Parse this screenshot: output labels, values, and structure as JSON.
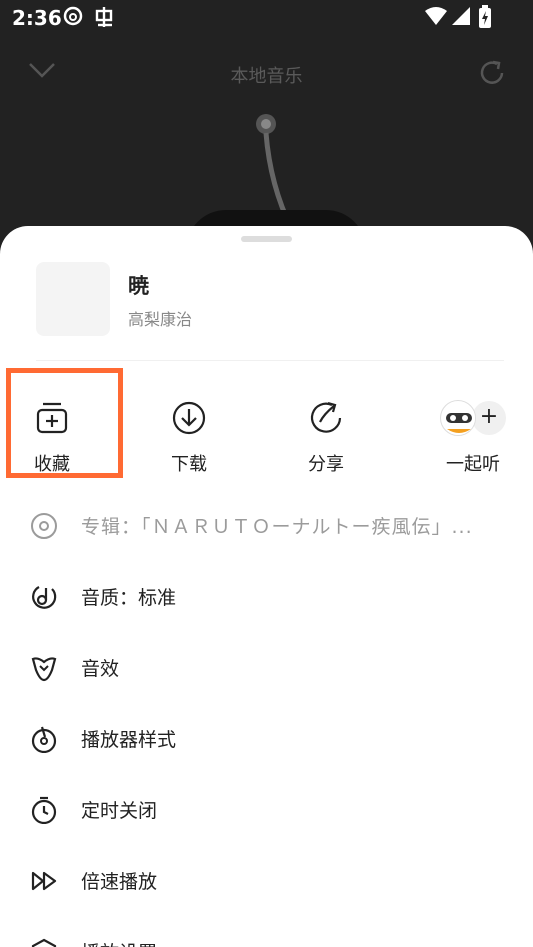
{
  "status": {
    "time": "2:36"
  },
  "player": {
    "title": "本地音乐"
  },
  "song": {
    "title": "暁",
    "artist": "高梨康治"
  },
  "actions": [
    {
      "label": "收藏",
      "icon": "add-to-playlist-icon"
    },
    {
      "label": "下载",
      "icon": "download-icon"
    },
    {
      "label": "分享",
      "icon": "share-icon"
    },
    {
      "label": "一起听",
      "icon": "listen-together-icon"
    }
  ],
  "together_plus": "+",
  "menu": [
    {
      "label": "专辑：「ＮＡＲＵＴＯーナルトー疾風伝」...",
      "icon": "album-disc-icon"
    },
    {
      "label": "音质：标准",
      "icon": "audio-quality-icon"
    },
    {
      "label": "音效",
      "icon": "sound-effect-icon"
    },
    {
      "label": "播放器样式",
      "icon": "player-style-icon"
    },
    {
      "label": "定时关闭",
      "icon": "timer-icon"
    },
    {
      "label": "倍速播放",
      "icon": "playback-speed-icon"
    },
    {
      "label": "播放设置",
      "icon": "playback-settings-icon"
    }
  ],
  "colors": {
    "highlight": "#ff6a33",
    "sheet": "#ffffff",
    "backdrop": "#222222"
  }
}
